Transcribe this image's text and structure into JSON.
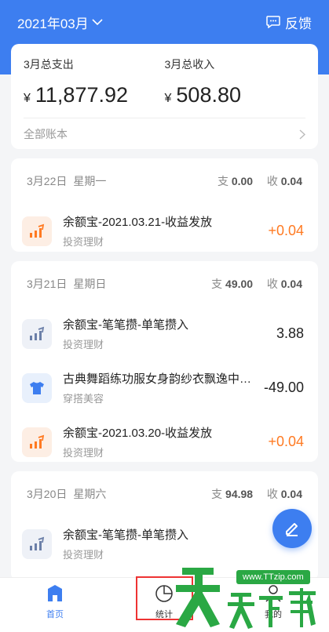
{
  "colors": {
    "brand": "#3d7ef0",
    "income": "#ff7a22",
    "highlight": "#e33333",
    "watermark_green": "#2aa844"
  },
  "topbar": {
    "month": "2021年03月",
    "feedback_label": "反馈"
  },
  "summary": {
    "expense_label": "3月总支出",
    "expense_currency": "¥",
    "expense_amount": "11,877.92",
    "income_label": "3月总收入",
    "income_currency": "¥",
    "income_amount": "508.80",
    "all_accounts_label": "全部账本"
  },
  "days": [
    {
      "date": "3月22日",
      "weekday": "星期一",
      "expense_prefix": "支",
      "expense": "0.00",
      "income_prefix": "收",
      "income": "0.04",
      "transactions": [
        {
          "title": "余额宝-2021.03.21-收益发放",
          "category": "投资理财",
          "amount": "+0.04",
          "icon": "chart-up-icon"
        }
      ]
    },
    {
      "date": "3月21日",
      "weekday": "星期日",
      "expense_prefix": "支",
      "expense": "49.00",
      "income_prefix": "收",
      "income": "0.04",
      "transactions": [
        {
          "title": "余额宝-笔笔攒-单笔攒入",
          "category": "投资理财",
          "amount": "3.88",
          "icon": "bar-chart-icon"
        },
        {
          "title": "古典舞蹈练功服女身韵纱衣飘逸中…",
          "category": "穿搭美容",
          "amount": "-49.00",
          "icon": "tshirt-icon"
        },
        {
          "title": "余额宝-2021.03.20-收益发放",
          "category": "投资理财",
          "amount": "+0.04",
          "icon": "chart-up-icon"
        }
      ]
    },
    {
      "date": "3月20日",
      "weekday": "星期六",
      "expense_prefix": "支",
      "expense": "94.98",
      "income_prefix": "收",
      "income": "0.04",
      "transactions": [
        {
          "title": "余额宝-笔笔攒-单笔攒入",
          "category": "投资理财",
          "amount": "",
          "icon": "bar-chart-icon"
        }
      ]
    }
  ],
  "bottom_nav": {
    "home": "首页",
    "stats": "统计",
    "mine": "我的"
  },
  "watermark": {
    "url": "www.TTzip.com",
    "text": "天天下载"
  }
}
